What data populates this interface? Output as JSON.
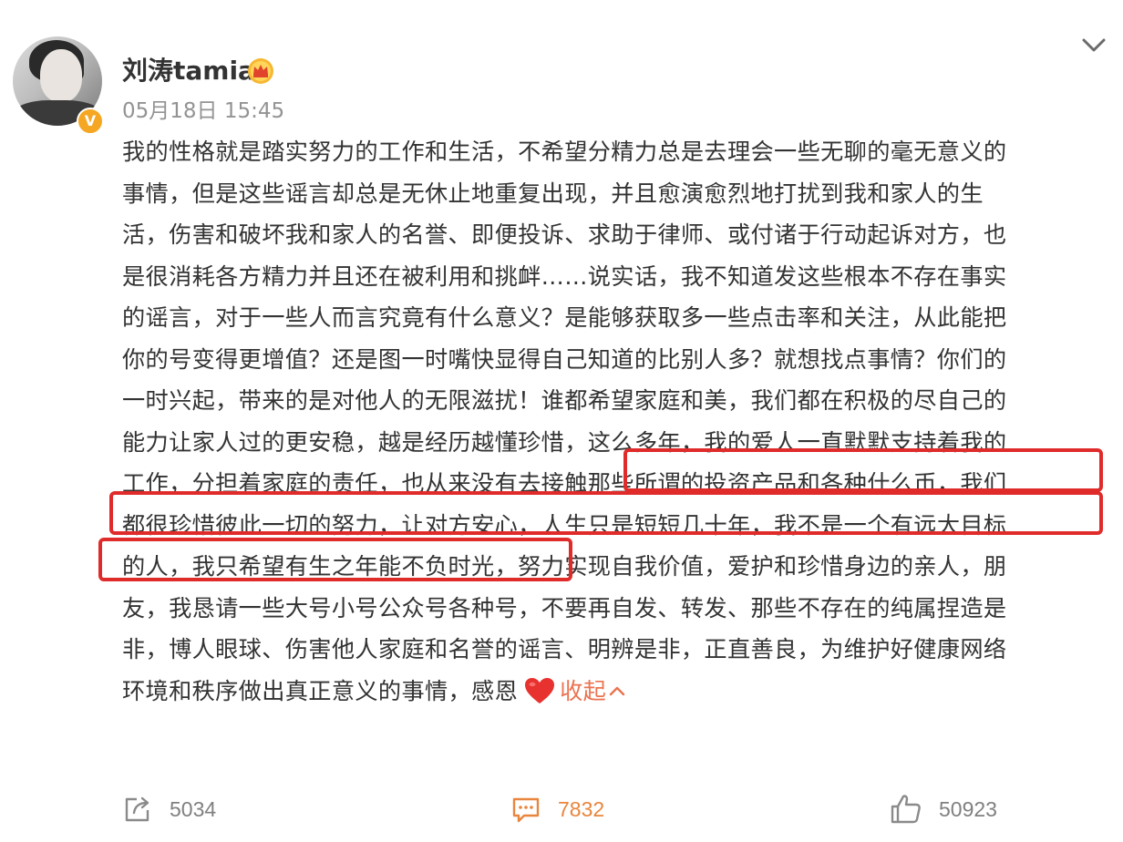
{
  "post": {
    "author": {
      "name": "刘涛tamia",
      "avatar": "user-avatar",
      "verified": true,
      "badge_icon": "verified-v-icon",
      "vip_icon": "vip-crown-icon"
    },
    "timestamp": "05月18日 15:45",
    "body_lines": [
      [
        "我的性格就是踏实努力的工作和生活，不希望分精力总是去理会一些无聊的毫无意义的"
      ],
      [
        "事情，但是这些谣言却总是无休止地重复出现，并且愈演愈烈地打扰到我和家人的生"
      ],
      [
        "活，伤害和破坏我和家人的名誉、即便投诉、求助于律师、或付诸于行动起诉对方，也"
      ],
      [
        "是很消耗各方精力并且还在被利用和挑衅……说实话，我不知道发这些根本不存在事实"
      ],
      [
        "的谣言，对于一些人而言究竟有什么意义？是能够获取多一些点击率和关注，从此能把"
      ],
      [
        "你的号变得更增值？还是图一时嘴快显得自己知道的比别人多？就想找点事情？你们的"
      ],
      [
        "一时兴起，带来的是对他人的无限滋扰！谁都希望家庭和美，我们都在积极的尽自己的"
      ],
      [
        "能力让家人过的更安稳，越是经历越懂珍惜，",
        "这么多年，我的爱人一直默默支持着我的"
      ],
      [
        "工作，分担着家庭的责任，也从来没有去接触那些所谓的投资产品和各种什么币，我们"
      ],
      [
        "都很珍惜彼此一切的努力，让对方安心，",
        "人生只是短短几十年，我不是一个有远大目标"
      ],
      [
        "的人，我只希望有生之年能不负时光，努力实现自我价值，爱护和珍惜身边的亲人，朋"
      ],
      [
        "友，我恳请一些大号小号公众号各种号，不要再自发、转发、那些不存在的纯属捏造是"
      ],
      [
        "非，博人眼球、伤害他人家庭和名誉的谣言、明辨是非，正直善良，为维护好健康网络"
      ],
      [
        "环境和秩序做出真正意义的事情，感恩"
      ]
    ],
    "heart_icon": "red-heart-icon",
    "collapse_label": "收起",
    "collapse_icon": "chevron-up-icon",
    "highlight_color": "#e02b2b",
    "link_color": "#eb7350"
  },
  "actions": {
    "repost": {
      "icon": "repost-icon",
      "count": "5034"
    },
    "comment": {
      "icon": "comment-icon",
      "count": "7832"
    },
    "like": {
      "icon": "thumbs-up-icon",
      "count": "50923"
    }
  },
  "more_icon": "chevron-down-icon"
}
